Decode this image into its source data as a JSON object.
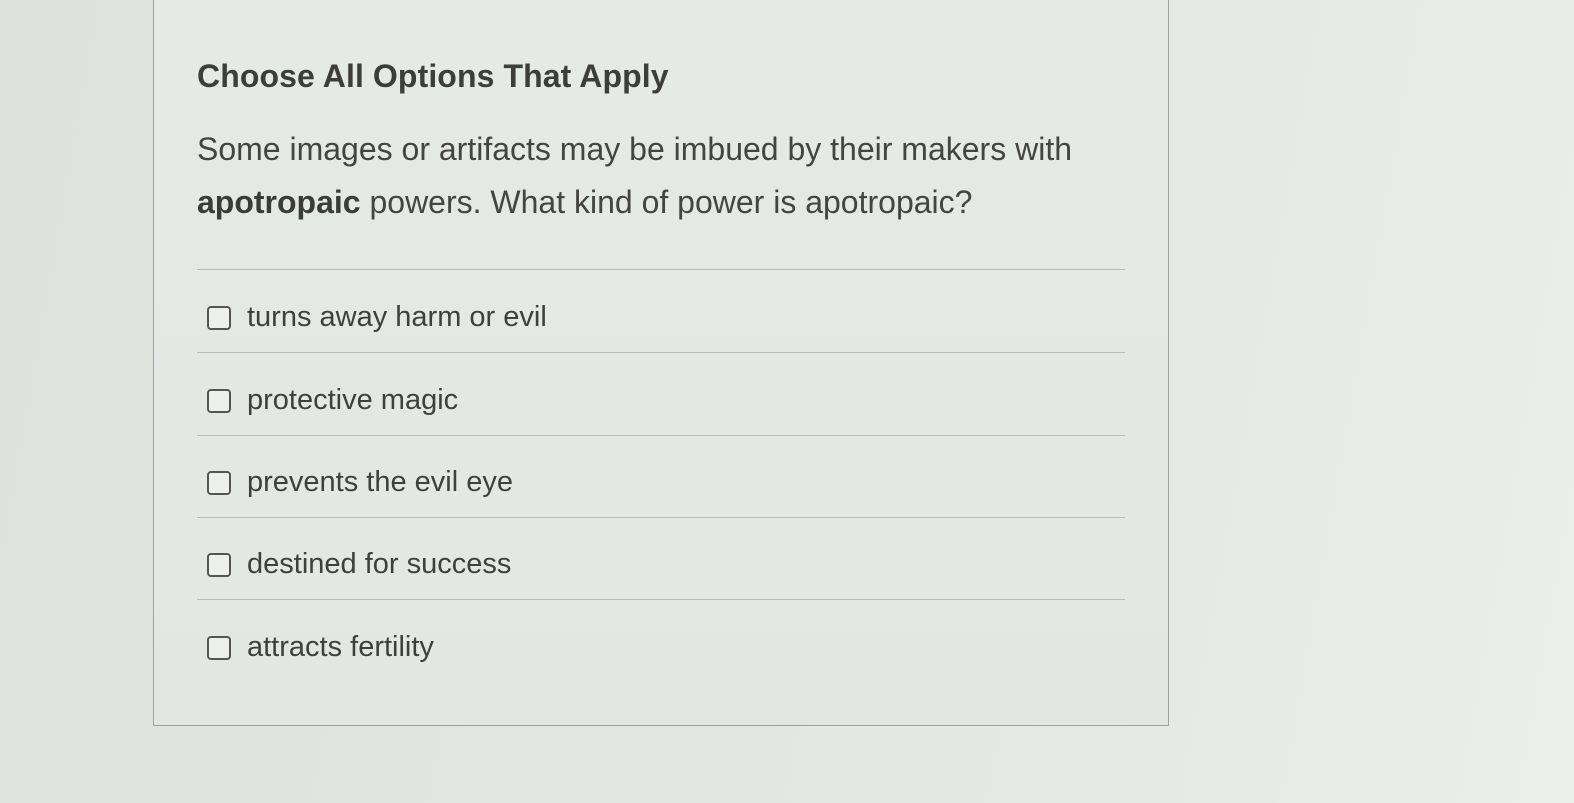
{
  "question_card": {
    "heading": "Choose All Options That Apply",
    "question_before": "Some images or artifacts may be imbued by their makers with ",
    "question_bold": "apotropaic",
    "question_after": " powers.  What kind of power is apotropaic?",
    "options": [
      {
        "label": "turns away harm or evil",
        "checked": false
      },
      {
        "label": "protective magic",
        "checked": false
      },
      {
        "label": "prevents the evil eye",
        "checked": false
      },
      {
        "label": "destined for success",
        "checked": false
      },
      {
        "label": "attracts fertility",
        "checked": false
      }
    ]
  }
}
